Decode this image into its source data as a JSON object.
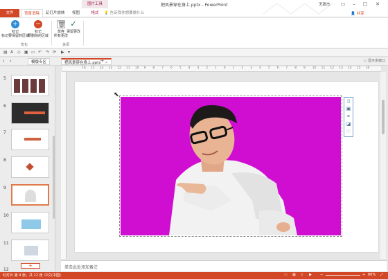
{
  "window": {
    "title": "把风景穿在身上.pptx - PowerPoint",
    "context_group": "图片工具",
    "account": "无锐杰",
    "share_label": "共享"
  },
  "ribbon_tabs": {
    "file": "文件",
    "remove_background": "背景消除",
    "animations": "幻灯片放映",
    "view": "视图",
    "format": "格式",
    "tell_me": "告诉我你想要做什么"
  },
  "ribbon": {
    "mark_keep": "标记要保留的区域",
    "mark_keep_top": "标记",
    "mark_remove_top": "标记",
    "mark_remove": "要删除的区域",
    "discard_top": "放弃",
    "discard": "所有更改",
    "keep_changes": "保留更改",
    "group_refine": "优化",
    "group_close": "关闭"
  },
  "tabstrip": {
    "tab1": "模版专区",
    "tab2": "把风景穿在身上.pptx",
    "show_all": "显示多窗口"
  },
  "thumbnails": {
    "numbers": [
      "5",
      "6",
      "7",
      "8",
      "9",
      "10",
      "11",
      "12"
    ],
    "add": "+"
  },
  "ruler": {
    "ticks": [
      "16",
      "15",
      "14",
      "13",
      "12",
      "11",
      "10",
      "9",
      "8",
      "7",
      "6",
      "5",
      "4",
      "3",
      "2",
      "1",
      "0",
      "1",
      "2",
      "3",
      "4",
      "5",
      "6",
      "7",
      "8",
      "9",
      "10",
      "11",
      "12",
      "13",
      "14",
      "15",
      "16"
    ]
  },
  "notes": {
    "placeholder": "单击此处添加备注"
  },
  "status": {
    "slide_info": "幻灯片 第 9 张，共 12 张",
    "language": "中文(中国)",
    "zoom": "80%"
  },
  "colors": {
    "accent": "#d24726",
    "photo_bg": "#d00ed2"
  }
}
